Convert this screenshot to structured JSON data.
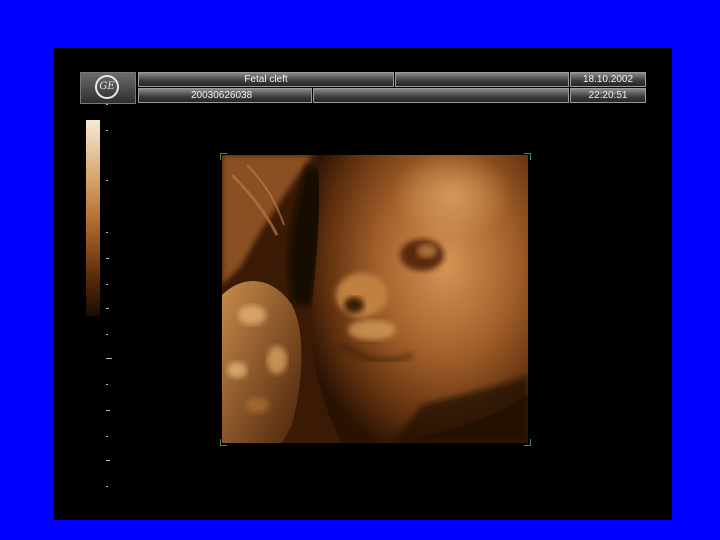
{
  "header": {
    "logo_text": "GE",
    "title": "Fetal cleft",
    "patient_id": "20030626038",
    "date": "18.10.2002",
    "time": "22:20:51"
  },
  "colors": {
    "background": "#0000ff",
    "screen": "#000000",
    "tissue": "#a0602a"
  },
  "icons": [
    "ge-logo-icon"
  ]
}
